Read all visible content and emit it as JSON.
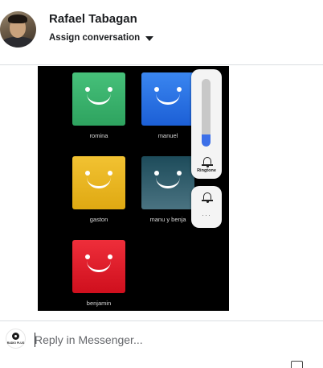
{
  "header": {
    "name": "Rafael Tabagan",
    "assign_label": "Assign conversation",
    "avatar_icon": "user-avatar-icon"
  },
  "attachment": {
    "profiles": [
      {
        "label": "romina",
        "color_top": "#46c07a",
        "color_bottom": "#2ea35f"
      },
      {
        "label": "manuel",
        "color_top": "#3a86f0",
        "color_bottom": "#1c5fd6"
      },
      {
        "label": "gaston",
        "color_top": "#f2c232",
        "color_bottom": "#dfa912"
      },
      {
        "label": "manu y benja",
        "color_top": "#1d4b5a",
        "color_bottom": "#4a7381"
      },
      {
        "label": "benjamin",
        "color_top": "#ee2e3a",
        "color_bottom": "#cf0f1d"
      }
    ],
    "volume": {
      "label": "Ringtone",
      "level": 0.18,
      "accent": "#3b6fe8",
      "more_label": "···"
    }
  },
  "composer": {
    "placeholder": "Reply in Messenger...",
    "page_avatar_text": "RADIO PLUS"
  }
}
